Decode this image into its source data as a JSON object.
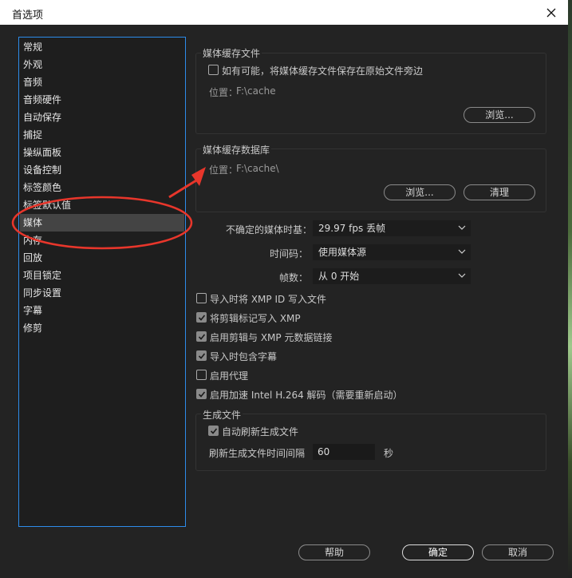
{
  "window": {
    "title": "首选项"
  },
  "sidebar": {
    "items": [
      {
        "label": "常规"
      },
      {
        "label": "外观"
      },
      {
        "label": "音频"
      },
      {
        "label": "音频硬件"
      },
      {
        "label": "自动保存"
      },
      {
        "label": "捕捉"
      },
      {
        "label": "操纵面板"
      },
      {
        "label": "设备控制"
      },
      {
        "label": "标签颜色"
      },
      {
        "label": "标签默认值"
      },
      {
        "label": "媒体",
        "selected": true
      },
      {
        "label": "内存"
      },
      {
        "label": "回放"
      },
      {
        "label": "项目锁定"
      },
      {
        "label": "同步设置"
      },
      {
        "label": "字幕"
      },
      {
        "label": "修剪"
      }
    ]
  },
  "media_cache_files": {
    "title": "媒体缓存文件",
    "save_next_label": "如有可能，将媒体缓存文件保存在原始文件旁边",
    "save_next_checked": false,
    "location_label": "位置：",
    "location_value": "F:\\cache",
    "browse_label": "浏览..."
  },
  "media_cache_db": {
    "title": "媒体缓存数据库",
    "location_label": "位置：",
    "location_value": "F:\\cache\\",
    "browse_label": "浏览...",
    "clean_label": "清理"
  },
  "settings": {
    "timebase_label": "不确定的媒体时基：",
    "timebase_value": "29.97 fps 丢帧",
    "timecode_label": "时间码：",
    "timecode_value": "使用媒体源",
    "frame_label": "帧数：",
    "frame_value": "从 0 开始"
  },
  "checkboxes": [
    {
      "label": "导入时将 XMP ID 写入文件",
      "checked": false
    },
    {
      "label": "将剪辑标记写入 XMP",
      "checked": true
    },
    {
      "label": "启用剪辑与 XMP 元数据链接",
      "checked": true
    },
    {
      "label": "导入时包含字幕",
      "checked": true
    },
    {
      "label": "启用代理",
      "checked": false
    },
    {
      "label": "启用加速 Intel H.264 解码（需要重新启动）",
      "checked": true
    }
  ],
  "growing_files": {
    "title": "生成文件",
    "auto_refresh_label": "自动刷新生成文件",
    "auto_refresh_checked": true,
    "interval_label": "刷新生成文件时间间隔",
    "interval_value": "60",
    "interval_unit": "秒"
  },
  "footer": {
    "help_label": "帮助",
    "ok_label": "确定",
    "cancel_label": "取消"
  },
  "colors": {
    "dialog_bg": "#232323",
    "sidebar_border": "#2d8ceb",
    "selected_item": "#444444",
    "annotation_red": "#e8362b"
  }
}
